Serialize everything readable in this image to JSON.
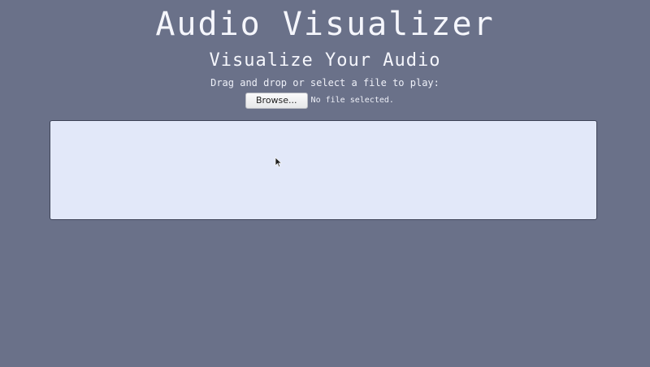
{
  "header": {
    "title": "Audio Visualizer",
    "subtitle": "Visualize Your Audio",
    "instructions": "Drag and drop or select a file to play:"
  },
  "file_input": {
    "browse_label": "Browse...",
    "status": "No file selected."
  },
  "colors": {
    "background": "#6a7189",
    "drop_zone": "#e2e8f9",
    "text": "#f5f6fc"
  },
  "icons": {
    "cursor": "mouse-pointer-icon"
  }
}
